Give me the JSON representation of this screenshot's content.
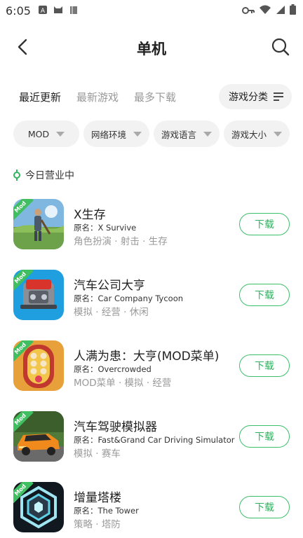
{
  "status_bar": {
    "time": "6:05",
    "left_icons": [
      "a-notification-icon",
      "cat-notification-icon",
      "book-notification-icon"
    ],
    "right_icons": [
      "vpn-key-icon",
      "wifi-icon",
      "signal-icon",
      "battery-icon"
    ]
  },
  "header": {
    "title": "单机"
  },
  "tabs": [
    {
      "label": "最近更新",
      "active": true
    },
    {
      "label": "最新游戏",
      "active": false
    },
    {
      "label": "最多下载",
      "active": false
    }
  ],
  "category_filter": {
    "label": "游戏分类"
  },
  "chips": [
    {
      "label": "MOD"
    },
    {
      "label": "网络环境"
    },
    {
      "label": "游戏语言"
    },
    {
      "label": "游戏大小"
    }
  ],
  "section": {
    "label": "今日营业中"
  },
  "games": [
    {
      "name": "X生存",
      "original": "原名：X Survive",
      "tags": "角色扮演 · 射击 · 生存",
      "badge": "Mod",
      "download": "下载"
    },
    {
      "name": "汽车公司大亨",
      "original": "原名：Car Company Tycoon",
      "tags": "模拟 · 经营 · 休闲",
      "badge": "Mod",
      "download": "下载"
    },
    {
      "name": "人满为患：大亨(MOD菜单)",
      "original": "原名：Overcrowded",
      "tags": "MOD菜单 · 模拟 · 经营",
      "badge": "Mod",
      "download": "下载"
    },
    {
      "name": "汽车驾驶模拟器",
      "original": "原名：Fast&Grand Car Driving Simulator",
      "tags": "模拟 · 赛车",
      "badge": "Mod",
      "download": "下载"
    },
    {
      "name": "增量塔楼",
      "original": "原名：The Tower",
      "tags": "策略 · 塔防",
      "badge": "Mod",
      "download": "下载"
    }
  ],
  "colors": {
    "accent": "#3cbf6a",
    "badge": "#3fbf5f",
    "muted": "#999999"
  }
}
